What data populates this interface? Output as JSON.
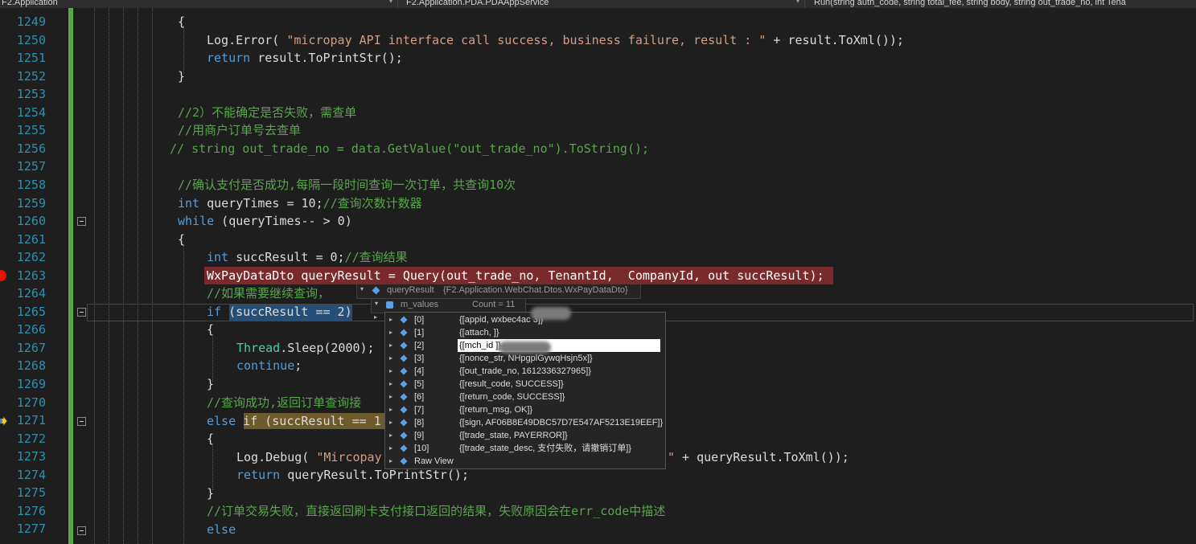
{
  "nav": {
    "project": "F2.Application",
    "type": "F2.Application.PDA.PDAAppService",
    "member": "Run(string auth_code, string total_fee, string body, string out_trade_no, int Tena"
  },
  "lines": [
    {
      "n": "1249"
    },
    {
      "n": "1250"
    },
    {
      "n": "1251"
    },
    {
      "n": "1252"
    },
    {
      "n": "1253"
    },
    {
      "n": "1254"
    },
    {
      "n": "1255"
    },
    {
      "n": "1256"
    },
    {
      "n": "1257"
    },
    {
      "n": "1258"
    },
    {
      "n": "1259"
    },
    {
      "n": "1260"
    },
    {
      "n": "1261"
    },
    {
      "n": "1262"
    },
    {
      "n": "1263"
    },
    {
      "n": "1264"
    },
    {
      "n": "1265"
    },
    {
      "n": "1266"
    },
    {
      "n": "1267"
    },
    {
      "n": "1268"
    },
    {
      "n": "1269"
    },
    {
      "n": "1270"
    },
    {
      "n": "1271"
    },
    {
      "n": "1272"
    },
    {
      "n": "1273"
    },
    {
      "n": "1274"
    },
    {
      "n": "1275"
    },
    {
      "n": "1276"
    },
    {
      "n": "1277"
    }
  ],
  "code": {
    "l1249": "{",
    "l1250_a": "Log.Error( ",
    "l1250_b": "\"micropay API interface call success, business failure, result : \"",
    "l1250_c": " + result.ToXml());",
    "l1251_kw": "return",
    "l1251_rest": " result.ToPrintStr();",
    "l1252": "}",
    "l1254": "//2）不能确定是否失败，需查单",
    "l1255": "//用商户订单号去查单",
    "l1256": "// string out_trade_no = data.GetValue(\"out_trade_no\").ToString();",
    "l1258": "//确认支付是否成功,每隔一段时间查询一次订单，共查询10次",
    "l1259_kw": "int",
    "l1259_rest": " queryTimes = 10;",
    "l1259_cm": "//查询次数计数器",
    "l1260_kw": "while",
    "l1260_rest": " (queryTimes-- > 0)",
    "l1261": "{",
    "l1262_kw": "int",
    "l1262_rest": " succResult = 0;",
    "l1262_cm": "//查询结果",
    "l1263": "WxPayDataDto queryResult = Query(out_trade_no, TenantId,  CompanyId, out succResult);",
    "l1264": "//如果需要继续查询，",
    "l1265_kw": "if",
    "l1265_rest": " (succResult == 2)",
    "l1266": "{",
    "l1267_ty": "Thread",
    "l1267_rest": ".Sleep(2000);",
    "l1268_kw": "continue",
    "l1268_rest": ";",
    "l1269": "}",
    "l1270": "//查询成功,返回订单查询接",
    "l1271_kw": "else",
    "l1271_hl": "if (succResult == 1",
    "l1272": "{",
    "l1273_a": "Log.Debug( ",
    "l1273_b": "\"Mircopay",
    "l1273_c": "\" + queryResult.ToXml());",
    "l1274_kw": "return",
    "l1274_rest": " queryResult.ToPrintStr();",
    "l1275": "}",
    "l1276": "//订单交易失败，直接返回刷卡支付接口返回的结果，失败原因会在err_code中描述",
    "l1277_kw": "else"
  },
  "datatip": {
    "root_name": "queryResult",
    "root_type": "{F2.Application.WebChat.Dtos.WxPayDataDto}",
    "child_name": "m_values",
    "child_count": "Count = 11",
    "items": [
      {
        "idx": "[0]",
        "val": "{[appid, wxbec4ac                 3]}"
      },
      {
        "idx": "[1]",
        "val": "{[attach, ]}"
      },
      {
        "idx": "[2]",
        "val": "{[mch_id                   ]}"
      },
      {
        "idx": "[3]",
        "val": "{[nonce_str, NHpgplGywqHsjn5x]}"
      },
      {
        "idx": "[4]",
        "val": "{[out_trade_no, 1612336327965]}"
      },
      {
        "idx": "[5]",
        "val": "{[result_code, SUCCESS]}"
      },
      {
        "idx": "[6]",
        "val": "{[return_code, SUCCESS]}"
      },
      {
        "idx": "[7]",
        "val": "{[return_msg, OK]}"
      },
      {
        "idx": "[8]",
        "val": "{[sign, AF06B8E49DBC57D7E547AF5213E19EEF]}"
      },
      {
        "idx": "[9]",
        "val": "{[trade_state, PAYERROR]}"
      },
      {
        "idx": "[10]",
        "val": "{[trade_state_desc, 支付失败，请撤销订单]}"
      },
      {
        "idx": "Raw View",
        "val": ""
      }
    ]
  },
  "colors": {
    "keyword": "#569cd6",
    "comment": "#57a64a",
    "string": "#d69d85",
    "type": "#4ec9b0",
    "line_number": "#2b91af",
    "breakpoint": "#e51400"
  }
}
